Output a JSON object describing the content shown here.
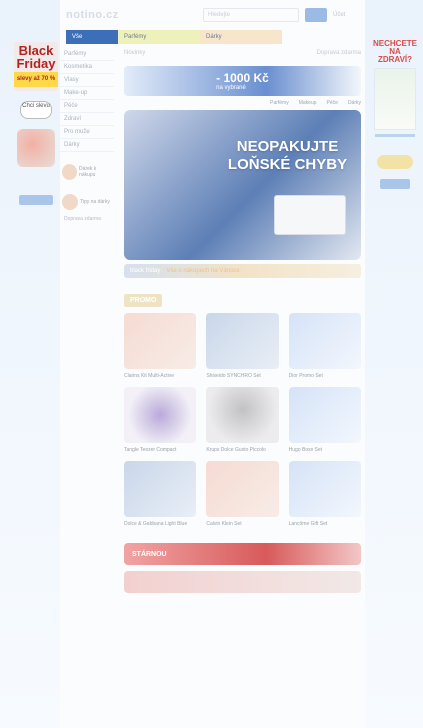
{
  "ad_left": {
    "badge_title": "Black Friday",
    "badge_sub": "slevy až 70 %",
    "button_label": "Chci slevu"
  },
  "ad_right": {
    "title": "NECHCETE NA ZDRAVÍ?"
  },
  "header": {
    "logo": "notino.cz",
    "search_placeholder": "Hledejte",
    "account": "Účet"
  },
  "tabs": [
    {
      "label": "Vše"
    },
    {
      "label": "Parfémy"
    },
    {
      "label": "Dárky"
    }
  ],
  "sidebar": {
    "items": [
      "Parfémy",
      "Kosmetika",
      "Vlasy",
      "Make-up",
      "Péče",
      "Zdraví",
      "Pro muže",
      "Dárky"
    ],
    "promos": [
      {
        "text": "Dárek k nákupu"
      },
      {
        "text": "Tipy na dárky"
      }
    ],
    "note": "Doprava zdarma"
  },
  "main": {
    "top_left": "Novinky",
    "top_right": "Doprava zdarma",
    "hero1_amount": "- 1000 Kč",
    "hero1_sub": "na vybrané",
    "subnav": [
      "Parfémy",
      "Makeup",
      "Péče",
      "Dárky"
    ],
    "hero2_headline": "NEOPAKUJTE LOŇSKÉ CHYBY",
    "ribbon_label": "black friday",
    "ribbon_text": "Vše o nákupech na Vánoce"
  },
  "promo_section": {
    "tag": "PROMO",
    "products": [
      {
        "name": "Clarins Kit Multi-Active",
        "style": "img"
      },
      {
        "name": "Shiseido SYNCHRO Set",
        "style": "dark"
      },
      {
        "name": "Dior Promo Set",
        "style": "box"
      },
      {
        "name": "Tangle Teezer Compact",
        "style": "purple"
      },
      {
        "name": "Krups Dolce Gusto Piccolo",
        "style": "grey"
      },
      {
        "name": "Hugo Boss Set",
        "style": "box"
      },
      {
        "name": "Dolce & Gabbana Light Blue",
        "style": "dark"
      },
      {
        "name": "Calvin Klein Set",
        "style": "img"
      },
      {
        "name": "Lancôme Gift Set",
        "style": "box"
      }
    ]
  },
  "bars": {
    "bar1_label": "STÁRNOU"
  }
}
